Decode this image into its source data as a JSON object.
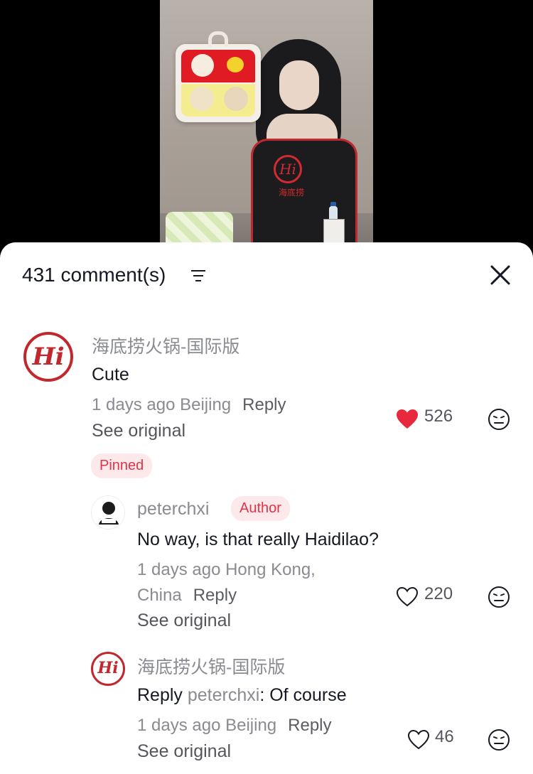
{
  "header": {
    "comment_count": "431 comment(s)"
  },
  "comments": [
    {
      "username": "海底捞火锅-国际版",
      "text": "Cute",
      "time": "1 days ago Beijing",
      "reply_label": "Reply",
      "see_original": "See original",
      "likes": "526",
      "liked": true,
      "badge": "Pinned",
      "avatar_icon": "haidilao-logo-icon"
    },
    {
      "username": "peterchxi",
      "badge": "Author",
      "text": "No way, is that really Haidilao?",
      "time_line1": "1 days ago Hong Kong,",
      "time_line2": "China",
      "reply_label": "Reply",
      "see_original": "See original",
      "likes": "220",
      "liked": false
    },
    {
      "username": "海底捞火锅-国际版",
      "reply_prefix": "Reply",
      "reply_to": "peterchxi",
      "text": ": Of course",
      "time": "1 days ago Beijing",
      "reply_label": "Reply",
      "see_original": "See original",
      "likes": "46",
      "liked": false
    }
  ],
  "video": {
    "apron_text": "海底捞"
  },
  "colors": {
    "like_red": "#e8283c",
    "brand_red": "#c1272d",
    "badge_bg": "#fde8ea",
    "badge_text": "#e1344a"
  }
}
